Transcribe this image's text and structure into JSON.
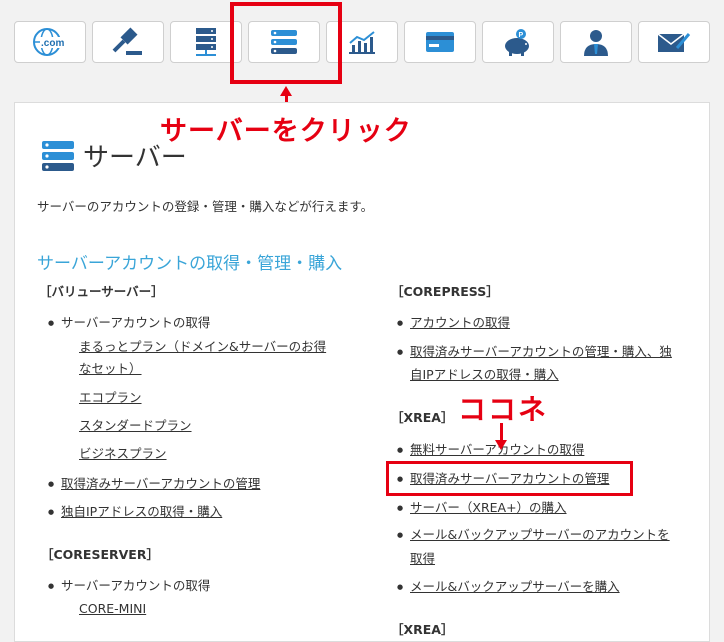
{
  "toolbar": {
    "buttons": [
      {
        "name": "domain",
        "icon": "globe-dotcom-icon"
      },
      {
        "name": "auction",
        "icon": "gavel-icon"
      },
      {
        "name": "server-admin",
        "icon": "server-stack-icon"
      },
      {
        "name": "server",
        "icon": "server-icon"
      },
      {
        "name": "report",
        "icon": "chart-icon"
      },
      {
        "name": "payment",
        "icon": "credit-card-icon"
      },
      {
        "name": "points",
        "icon": "piggy-bank-icon"
      },
      {
        "name": "member",
        "icon": "user-icon"
      },
      {
        "name": "mail",
        "icon": "mail-icon"
      }
    ]
  },
  "annotations": {
    "click_server": "サーバーをクリック",
    "here": "ココネ"
  },
  "page": {
    "title": "サーバー",
    "description": "サーバーのアカウントの登録・管理・購入などが行えます。",
    "section_title": "サーバーアカウントの取得・管理・購入"
  },
  "left": {
    "value_server": {
      "heading": "［バリューサーバー］",
      "item1": "サーバーアカウントの取得",
      "sub1a": "まるっとプラン（ドメイン&サーバーのお得",
      "sub1b": "なセット）",
      "sub2": "エコプラン",
      "sub3": "スタンダードプラン",
      "sub4": "ビジネスプラン",
      "item2": "取得済みサーバーアカウントの管理",
      "item3": "独自IPアドレスの取得・購入"
    },
    "coreserver": {
      "heading": "［CORESERVER］",
      "item1": "サーバーアカウントの取得",
      "sub1": "CORE-MINI"
    }
  },
  "right": {
    "corepress": {
      "heading": "［COREPRESS］",
      "item1": "アカウントの取得",
      "item2a": "取得済みサーバーアカウントの管理・購入、独",
      "item2b": "自IPアドレスの取得・購入"
    },
    "xrea": {
      "heading": "［XREA］",
      "item1": "無料サーバーアカウントの取得",
      "item2": "取得済みサーバーアカウントの管理",
      "item3": "サーバー（XREA+）の購入",
      "item4a": "メール&バックアップサーバーのアカウントを",
      "item4b": "取得",
      "item5": "メール&バックアップサーバーを購入"
    },
    "next_heading": "［XREA］"
  },
  "colors": {
    "accent_blue": "#3aa5d8",
    "icon_blue": "#2c8fd6",
    "annotation_red": "#e60012"
  }
}
